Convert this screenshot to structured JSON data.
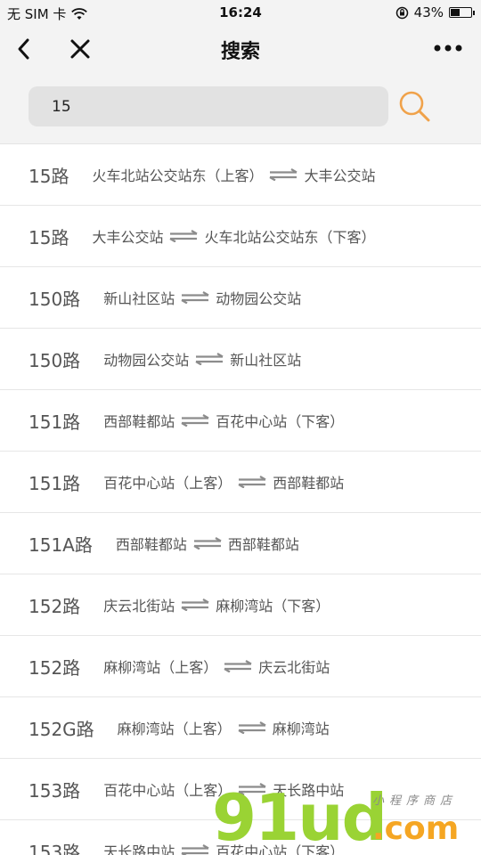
{
  "status_bar": {
    "carrier": "无 SIM 卡",
    "time": "16:24",
    "battery_text": "43%",
    "battery_level": 0.43
  },
  "nav": {
    "title": "搜索",
    "back_icon": "chevron-left-icon",
    "close_icon": "close-icon",
    "more_icon": "more-dots-icon"
  },
  "search": {
    "value": "15",
    "icon": "search-icon",
    "accent": "#f0a24a"
  },
  "routes": [
    {
      "name": "15路",
      "from": "火车北站公交站东（上客）",
      "to": "大丰公交站"
    },
    {
      "name": "15路",
      "from": "大丰公交站",
      "to": "火车北站公交站东（下客）"
    },
    {
      "name": "150路",
      "from": "新山社区站",
      "to": "动物园公交站"
    },
    {
      "name": "150路",
      "from": "动物园公交站",
      "to": "新山社区站"
    },
    {
      "name": "151路",
      "from": "西部鞋都站",
      "to": "百花中心站（下客）"
    },
    {
      "name": "151路",
      "from": "百花中心站（上客）",
      "to": "西部鞋都站"
    },
    {
      "name": "151A路",
      "from": "西部鞋都站",
      "to": "西部鞋都站"
    },
    {
      "name": "152路",
      "from": "庆云北街站",
      "to": "麻柳湾站（下客）"
    },
    {
      "name": "152路",
      "from": "麻柳湾站（上客）",
      "to": "庆云北街站"
    },
    {
      "name": "152G路",
      "from": "麻柳湾站（上客）",
      "to": "麻柳湾站"
    },
    {
      "name": "153路",
      "from": "百花中心站（上客）",
      "to": "天长路中站"
    },
    {
      "name": "153路",
      "from": "天长路中站",
      "to": "百花中心站（下客）"
    }
  ],
  "watermark": {
    "main": "91ud",
    "suffix": ".com",
    "small": "小程序商店"
  }
}
